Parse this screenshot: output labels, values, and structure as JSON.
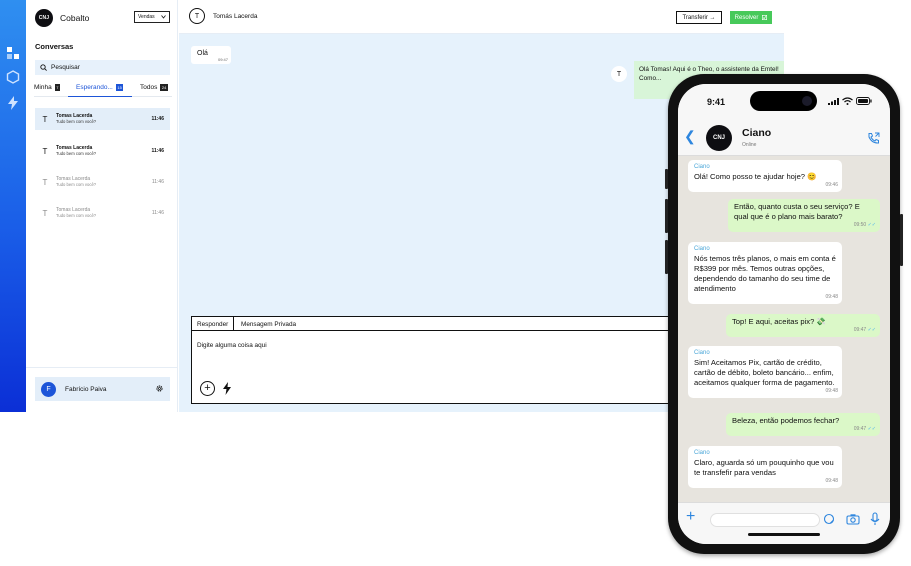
{
  "app": {
    "brand": "Cobalto",
    "logo_text": "CNJ",
    "department": "Vendas",
    "section_title": "Conversas",
    "search_placeholder": "Pesquisar",
    "tabs": [
      {
        "label": "Minha",
        "count": "7"
      },
      {
        "label": "Esperando...",
        "count": "15"
      },
      {
        "label": "Todos",
        "count": "24"
      }
    ],
    "conversations": [
      {
        "avatar": "T",
        "name": "Tomas Lacerda",
        "preview": "Tudo bem com você?",
        "time": "11:46"
      },
      {
        "avatar": "T",
        "name": "Tomas Lacerda",
        "preview": "Tudo bem com você?",
        "time": "11:46"
      },
      {
        "avatar": "T",
        "name": "Tomas Lacerda",
        "preview": "Tudo bem com você?",
        "time": "11:46"
      },
      {
        "avatar": "T",
        "name": "Tomas Lacerda",
        "preview": "Tudo bem com você?",
        "time": "11:46"
      }
    ],
    "user": {
      "avatar": "F",
      "name": "Fabrício Paiva"
    },
    "colors": {
      "accent": "#1d55d8",
      "resolve": "#47c95a",
      "chat_bg": "#e6f2fc"
    }
  },
  "chat": {
    "contact_avatar": "T",
    "contact_name": "Tomás Lacerda",
    "transfer_label": "Transferir →",
    "resolve_label": "Resolver",
    "incoming": {
      "text": "Olá",
      "time": "09:47"
    },
    "outgoing": {
      "avatar": "T",
      "text": "Olá Tomas! Aqui é o Theo, o assistente da Emtel! Como..."
    },
    "composer": {
      "tab_reply": "Responder",
      "tab_private": "Mensagem Privada",
      "placeholder": "Digite alguma coisa aqui",
      "add_icon": "+"
    }
  },
  "phone": {
    "clock": "9:41",
    "contact": "Ciano",
    "contact_status": "Online",
    "logo_text": "CNJ",
    "messages": [
      {
        "dir": "in",
        "sender": "Ciano",
        "text": "Olá! Como posso te ajudar hoje? 😊",
        "time": "09:46"
      },
      {
        "dir": "out",
        "text": "Então, quanto custa o seu serviço? E qual que é o plano mais barato?",
        "time": "09:50"
      },
      {
        "dir": "in",
        "sender": "Ciano",
        "text": "Nós temos três planos, o mais em conta é R$399 por mês. Temos outras opções, dependendo do tamanho do seu time de atendimento",
        "time": "09:48"
      },
      {
        "dir": "out",
        "text": "Top! E aqui, aceitas pix? 💸",
        "time": "09:47"
      },
      {
        "dir": "in",
        "sender": "Ciano",
        "text": "Sim! Aceitamos Pix, cartão de crédito, cartão de débito, boleto bancário... enfim, aceitamos qualquer forma de pagamento.",
        "time": "09:48"
      },
      {
        "dir": "out",
        "text": "Beleza, então podemos fechar?",
        "time": "09:47"
      },
      {
        "dir": "in",
        "sender": "Ciano",
        "text": "Claro, aguarda só um pouquinho que vou te transfefir para vendas",
        "time": "09:48"
      }
    ],
    "colors": {
      "link": "#2e86de",
      "bubble_out": "#dbf8c8",
      "sender": "#4aa6d8"
    }
  }
}
